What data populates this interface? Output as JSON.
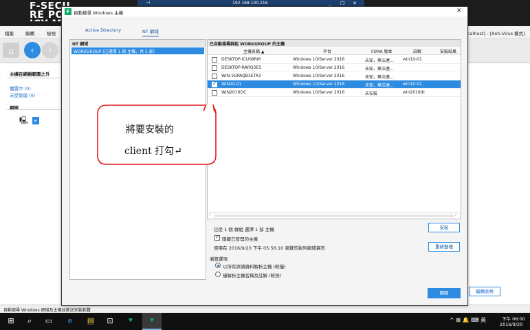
{
  "rdp": {
    "host": "192.168.100.216"
  },
  "app": {
    "logo": "F-SECURE POLICY MANAGER",
    "menu": [
      "檔案",
      "編輯",
      "檢視"
    ],
    "menu_right": "calhost] - [Anti-Virus 模式]"
  },
  "left_pane": {
    "scope_title": "主機在網樹範圍之外",
    "link_pending": "擱置中 (0)",
    "link_unmanaged": "未受管理 (0)",
    "domain_tree_title": "網樹"
  },
  "status_bar": {
    "text": "自動搜尋 Windows 網域及主機並推送安裝軟體"
  },
  "dialog": {
    "title": "自動搜尋 Windows 主機",
    "tabs": [
      {
        "label": "Active Directory",
        "active": false
      },
      {
        "label": "NT 網域",
        "active": true
      }
    ],
    "nt_panel": {
      "header": "NT 網域",
      "workgroup_row": "WORKGROUP (已選擇 1 部 主機，共 5 部)"
    },
    "hosts_panel": {
      "header": "已自動搜尋群組 WORKGROUP 的主機",
      "columns": [
        "主機名稱 ▲",
        "平台",
        "FSMA 版本",
        "註解",
        "安裝結果"
      ],
      "rows": [
        {
          "checked": false,
          "selected": false,
          "name": "DESKTOP-ICU08RM",
          "platform": "Windows 10/Server 2016",
          "fsma": "未知，無法連...",
          "comment": "win10-01",
          "result": ""
        },
        {
          "checked": false,
          "selected": false,
          "name": "DESKTOP-RARQ3E5",
          "platform": "Windows 10/Server 2016",
          "fsma": "未知，無法連...",
          "comment": "",
          "result": ""
        },
        {
          "checked": false,
          "selected": false,
          "name": "WIN-5GPAQB3ETA3",
          "platform": "Windows 10/Server 2016",
          "fsma": "未知，無法連...",
          "comment": "",
          "result": ""
        },
        {
          "checked": true,
          "selected": true,
          "name": "WIN10-01",
          "platform": "Windows 10/Server 2016",
          "fsma": "未知，無法連...",
          "comment": "win10-01",
          "result": ""
        },
        {
          "checked": false,
          "selected": false,
          "name": "WIN2016DC",
          "platform": "Windows 10/Server 2016",
          "fsma": "未安裝",
          "comment": "win2016dc",
          "result": ""
        }
      ]
    },
    "selection_info": "已從 1 個 群組 選擇 1 部 主機",
    "install_button": "安裝",
    "hide_managed_label": "隱藏已管理的主機",
    "hide_managed_checked": true,
    "last_updated": "使用在 2016/9/20 下午 05:56:10 瀏覽的執列網域資訊",
    "refresh_button": "重新整理",
    "scan_options_title": "瀏覽選項",
    "scan_options": [
      {
        "label": "以所有詳讀資料解析主機 (較慢)",
        "checked": true
      },
      {
        "label": "僅解析主機名稱及註解 (較快)",
        "checked": false
      }
    ],
    "close_button": "關閉"
  },
  "right_pane": {
    "edit_exclude_button": "編輯表格"
  },
  "callout": {
    "line1": "將要安裝的",
    "line2": "client  打勾↵"
  },
  "taskbar": {
    "tray": "^ ⊠ 🔔 ⌨ 英",
    "time": "下午 06:00",
    "date": "2016/9/20"
  }
}
